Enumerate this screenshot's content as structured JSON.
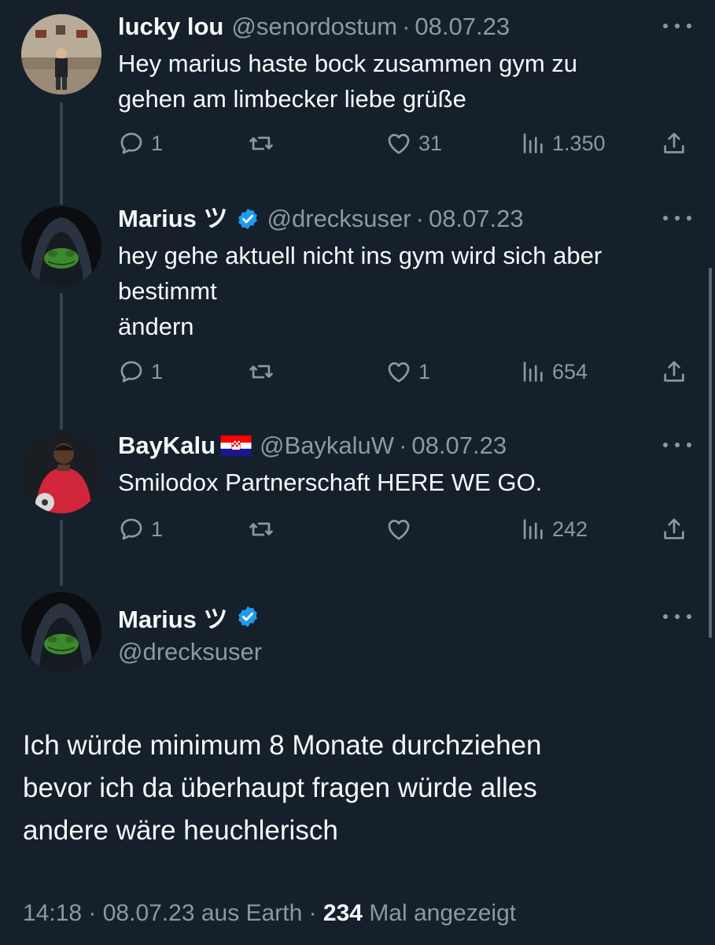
{
  "tweets": [
    {
      "name": "lucky lou",
      "handle": "@senordostum",
      "sep": "·",
      "date": "08.07.23",
      "text_lines": [
        "Hey marius haste bock zusammen gym zu",
        "gehen am limbecker liebe grüße"
      ],
      "replies": "1",
      "retweets": "",
      "likes": "31",
      "views": "1.350"
    },
    {
      "name": "Marius ツ",
      "handle": "@drecksuser",
      "sep": "·",
      "date": "08.07.23",
      "verified": true,
      "text_lines": [
        "hey gehe aktuell nicht ins gym wird sich aber",
        "bestimmt",
        "ändern"
      ],
      "replies": "1",
      "retweets": "",
      "likes": "1",
      "views": "654"
    },
    {
      "name": "BayKalu",
      "handle": "@BaykaluW",
      "sep": "·",
      "date": "08.07.23",
      "flag": "croatia-flag",
      "text_lines": [
        "Smilodox Partnerschaft HERE WE GO."
      ],
      "replies": "1",
      "retweets": "",
      "likes": "",
      "views": "242"
    }
  ],
  "main_tweet": {
    "name": "Marius ツ",
    "handle": "@drecksuser",
    "verified": true,
    "text_lines": [
      "Ich würde minimum 8 Monate durchziehen",
      "bevor ich da überhaupt fragen würde alles",
      "andere wäre heuchlerisch"
    ],
    "meta_time_date": "14:18 · 08.07.23 aus Earth · ",
    "meta_views_count": "234",
    "meta_views_label": " Mal angezeigt"
  },
  "colors": {
    "background": "#15202b",
    "text_primary": "#f7f9f9",
    "text_secondary": "#8b98a5",
    "verified_blue": "#1d9bf0",
    "thread_line": "#38444d"
  },
  "icons": [
    "reply-icon",
    "retweet-icon",
    "like-icon",
    "views-icon",
    "share-icon",
    "more-icon",
    "verified-badge-icon",
    "croatia-flag"
  ]
}
